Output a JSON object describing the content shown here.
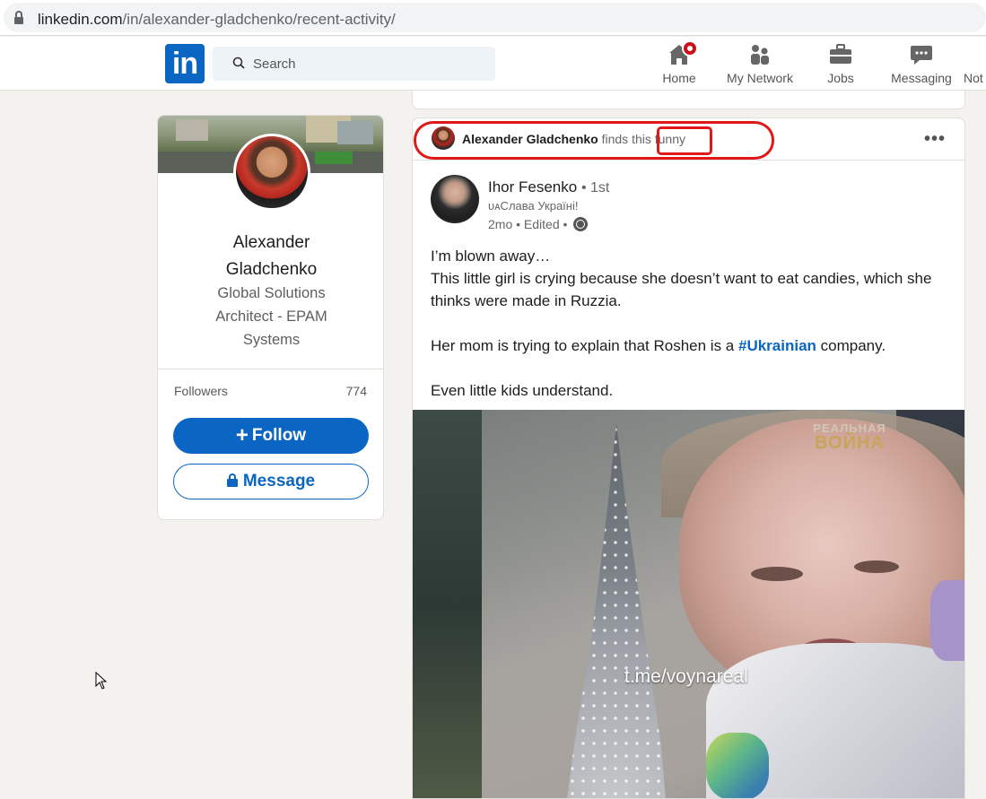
{
  "browser": {
    "url_host": "linkedin.com",
    "url_path": "/in/alexander-gladchenko/recent-activity/"
  },
  "nav": {
    "logo_text": "in",
    "search_placeholder": "Search",
    "items": [
      {
        "label": "Home",
        "icon": "home-icon",
        "has_badge": true
      },
      {
        "label": "My Network",
        "icon": "network-icon"
      },
      {
        "label": "Jobs",
        "icon": "briefcase-icon"
      },
      {
        "label": "Messaging",
        "icon": "messaging-icon"
      },
      {
        "label": "Not",
        "icon": "bell-icon"
      }
    ]
  },
  "profile": {
    "name": "Alexander Gladchenko",
    "headline": "Global Solutions Architect - EPAM Systems",
    "followers_label": "Followers",
    "followers_count": "774",
    "follow_label": "Follow",
    "follow_icon": "+",
    "message_label": "Message"
  },
  "post": {
    "activity": {
      "actor": "Alexander Gladchenko",
      "verb": "finds this",
      "reaction": "funny"
    },
    "more_label": "•••",
    "author": {
      "name": "Ihor Fesenko",
      "degree": "• 1st",
      "headline": "ᴜᴀСлава Україні!",
      "meta": "2mo • Edited •"
    },
    "text": {
      "line1": "I’m blown away…",
      "line2": "This little girl is crying because she doesn’t want to eat candies, which she thinks were made in Ruzzia.",
      "line3_before": "Her mom is trying to explain that Roshen is a ",
      "line3_hashtag": "#Ukrainian",
      "line3_after": " company.",
      "line4": "Even little kids understand."
    },
    "media": {
      "watermark_top": "РЕАЛЬНАЯ",
      "watermark_bottom": "ВОЙНА",
      "overlay_link": "t.me/voynareal"
    }
  },
  "colors": {
    "linkedin_blue": "#0a66c2",
    "annotation_red": "#e01818",
    "page_bg": "#f3f2ef"
  }
}
